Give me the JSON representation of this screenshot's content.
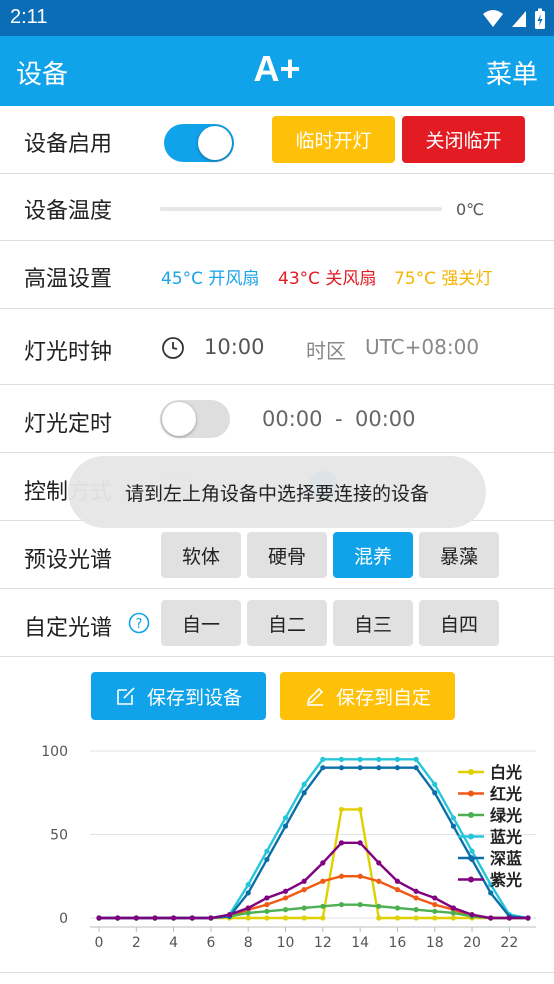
{
  "status_bar": {
    "time": "2:11"
  },
  "app_bar": {
    "left": "设备",
    "title": "A+",
    "right": "菜单"
  },
  "rows": {
    "enable": {
      "label": "设备启用",
      "toggle_on": true,
      "temp_light_button": "临时开灯",
      "close_temp_button": "关闭临开"
    },
    "temperature": {
      "label": "设备温度",
      "value": "0℃"
    },
    "high_temp": {
      "label": "高温设置",
      "fan_on": "45°C 开风扇",
      "fan_off": "43°C 关风扇",
      "light_off": "75°C 强关灯"
    },
    "clock": {
      "label": "灯光时钟",
      "time": "10:00",
      "timezone_label": "时区",
      "timezone": "UTC+08:00"
    },
    "timer": {
      "label": "灯光定时",
      "toggle_on": false,
      "start": "00:00",
      "separator": "-",
      "end": "00:00"
    },
    "control": {
      "label": "控制方式"
    },
    "preset": {
      "label": "预设光谱",
      "options": [
        "软体",
        "硬骨",
        "混养",
        "暴藻"
      ],
      "selected": "混养"
    },
    "custom": {
      "label": "自定光谱",
      "help_icon": "question-circle-icon",
      "options": [
        "自一",
        "自二",
        "自三",
        "自四"
      ]
    }
  },
  "toast": "请到左上角设备中选择要连接的设备",
  "actions": {
    "save_device": "保存到设备",
    "save_custom": "保存到自定"
  },
  "colors": {
    "primary": "#10a3ea",
    "status_bar": "#0b6db5",
    "orange": "#ffc107",
    "red": "#e31b23",
    "blue_text": "#1aa3e8",
    "red_text": "#e31b23",
    "yellow_text": "#f4b400"
  },
  "chart_data": {
    "type": "line",
    "x": [
      0,
      1,
      2,
      3,
      4,
      5,
      6,
      7,
      8,
      9,
      10,
      11,
      12,
      13,
      14,
      15,
      16,
      17,
      18,
      19,
      20,
      21,
      22,
      23
    ],
    "x_ticks": [
      0,
      2,
      4,
      6,
      8,
      10,
      12,
      14,
      16,
      18,
      20,
      22
    ],
    "y_ticks": [
      0,
      50,
      100
    ],
    "ylim": [
      0,
      100
    ],
    "xlim": [
      0,
      23
    ],
    "grid": true,
    "legend_position": "top-right",
    "series": [
      {
        "name": "白光",
        "color": "#e0d000",
        "values": [
          0,
          0,
          0,
          0,
          0,
          0,
          0,
          0,
          0,
          0,
          0,
          0,
          0,
          65,
          65,
          0,
          0,
          0,
          0,
          0,
          0,
          0,
          0,
          0
        ]
      },
      {
        "name": "红光",
        "color": "#f05a14",
        "values": [
          0,
          0,
          0,
          0,
          0,
          0,
          0,
          1,
          5,
          8,
          12,
          17,
          22,
          25,
          25,
          22,
          17,
          12,
          8,
          5,
          1,
          0,
          0,
          0
        ]
      },
      {
        "name": "绿光",
        "color": "#4caf50",
        "values": [
          0,
          0,
          0,
          0,
          0,
          0,
          0,
          1,
          3,
          4,
          5,
          6,
          7,
          8,
          8,
          7,
          6,
          5,
          4,
          3,
          1,
          0,
          0,
          0
        ]
      },
      {
        "name": "蓝光",
        "color": "#26c6da",
        "values": [
          0,
          0,
          0,
          0,
          0,
          0,
          0,
          2,
          20,
          40,
          60,
          80,
          95,
          95,
          95,
          95,
          95,
          95,
          80,
          60,
          40,
          20,
          2,
          0
        ]
      },
      {
        "name": "深蓝",
        "color": "#0a6fa8",
        "values": [
          0,
          0,
          0,
          0,
          0,
          0,
          0,
          1,
          15,
          35,
          55,
          75,
          90,
          90,
          90,
          90,
          90,
          90,
          75,
          55,
          35,
          15,
          1,
          0
        ]
      },
      {
        "name": "紫光",
        "color": "#800080",
        "values": [
          0,
          0,
          0,
          0,
          0,
          0,
          0,
          2,
          6,
          12,
          16,
          22,
          33,
          45,
          45,
          33,
          22,
          16,
          12,
          6,
          2,
          0,
          0,
          0
        ]
      }
    ]
  }
}
